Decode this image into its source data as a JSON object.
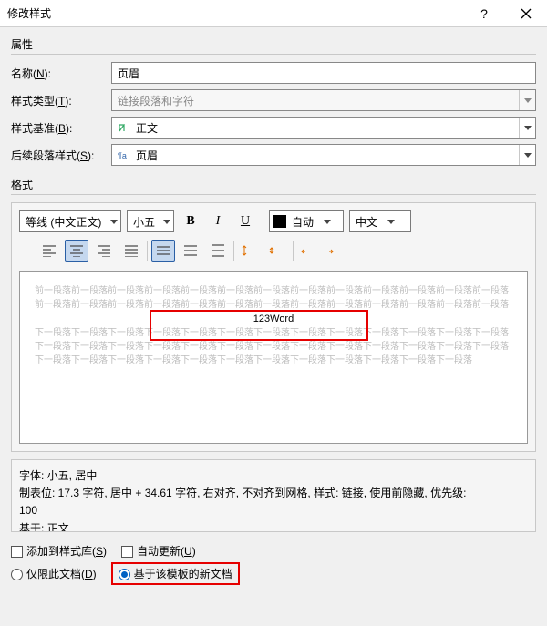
{
  "titlebar": {
    "title": "修改样式"
  },
  "groups": {
    "properties": "属性",
    "format": "格式"
  },
  "rows": {
    "name": {
      "label_pre": "名称(",
      "hotkey": "N",
      "label_post": "):",
      "value": "页眉"
    },
    "type": {
      "label_pre": "样式类型(",
      "hotkey": "T",
      "label_post": "):",
      "value": "链接段落和字符"
    },
    "basedon": {
      "label_pre": "样式基准(",
      "hotkey": "B",
      "label_post": "):",
      "value": "正文"
    },
    "next": {
      "label_pre": "后续段落样式(",
      "hotkey": "S",
      "label_post": "):",
      "value": "页眉"
    }
  },
  "toolbar": {
    "font": "等线 (中文正文)",
    "size": "小五",
    "bold": "B",
    "italic": "I",
    "underline": "U",
    "autoColor": "自动",
    "lang": "中文"
  },
  "preview": {
    "before": "前一段落前一段落前一段落前一段落前一段落前一段落前一段落前一段落前一段落前一段落前一段落前一段落前一段落前一段落前一段落前一段落前一段落前一段落前一段落前一段落前一段落前一段落前一段落前一段落前一段落前一段落",
    "sample": "123Word",
    "after": "下一段落下一段落下一段落下一段落下一段落下一段落下一段落下一段落下一段落下一段落下一段落下一段落下一段落下一段落下一段落下一段落下一段落下一段落下一段落下一段落下一段落下一段落下一段落下一段落下一段落下一段落下一段落下一段落下一段落下一段落下一段落下一段落下一段落下一段落下一段落下一段落下一段落下一段落"
  },
  "description": {
    "line1": "字体: 小五, 居中",
    "line2": "    制表位: 17.3 字符, 居中 + 34.61 字符, 右对齐, 不对齐到网格, 样式: 链接, 使用前隐藏, 优先级:",
    "line3": "100",
    "line4": "    基于: 正文"
  },
  "bottom": {
    "addToGallery_pre": "添加到样式库(",
    "addToGallery_hot": "S",
    "addToGallery_post": ")",
    "autoUpdate_pre": "自动更新(",
    "autoUpdate_hot": "U",
    "autoUpdate_post": ")",
    "onlyDoc_pre": "仅限此文档(",
    "onlyDoc_hot": "D",
    "onlyDoc_post": ")",
    "templateNew": "基于该模板的新文档"
  }
}
